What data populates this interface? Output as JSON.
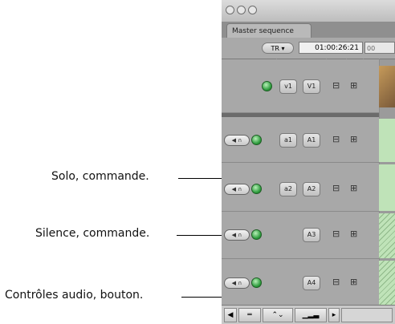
{
  "window": {
    "sequence_tab": "Master sequence",
    "timecode_mode": "TR",
    "timecode": "01:00:26:21",
    "ruler_partial": "00"
  },
  "tracks": {
    "video": {
      "source": "v1",
      "destination": "V1"
    },
    "audio": [
      {
        "source": "a1",
        "destination": "A1"
      },
      {
        "source": "a2",
        "destination": "A2"
      },
      {
        "source": "",
        "destination": "A3"
      },
      {
        "source": "",
        "destination": "A4"
      }
    ]
  },
  "callouts": {
    "solo": "Solo, commande.",
    "mute": "Silence, commande.",
    "audio_controls": "Contrôles audio, bouton."
  },
  "icons": {
    "audio_controls": "speaker-icon",
    "solo": "headphones-icon",
    "mute": "speaker-icon",
    "lock": "lock-icon",
    "visibility": "green-dot-icon"
  },
  "colors": {
    "panel": "#9b9b9b",
    "green_toggle": "#2b9a3b",
    "clip_green": "#bfe3b8"
  }
}
